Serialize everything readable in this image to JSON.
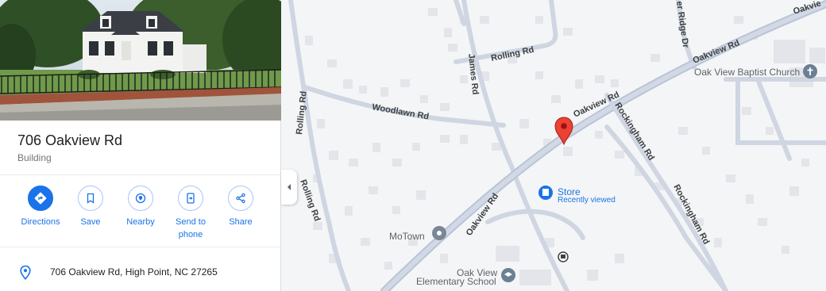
{
  "place": {
    "title": "706 Oakview Rd",
    "category": "Building",
    "address": "706 Oakview Rd, High Point, NC 27265"
  },
  "actions": [
    {
      "id": "directions",
      "label": "Directions",
      "icon": "directions-icon"
    },
    {
      "id": "save",
      "label": "Save",
      "icon": "bookmark-icon"
    },
    {
      "id": "nearby",
      "label": "Nearby",
      "icon": "nearby-icon"
    },
    {
      "id": "send",
      "label": "Send to phone",
      "label_line1": "Send to",
      "label_line2": "phone",
      "icon": "send-to-phone-icon"
    },
    {
      "id": "share",
      "label": "Share",
      "icon": "share-icon"
    }
  ],
  "map": {
    "roads": {
      "oakview_top": "Oakvie",
      "oakview_upper": "Oakview Rd",
      "oakview_mid": "Oakview Rd",
      "oakview_lower": "Oakview Rd",
      "james": "James Rd",
      "rolling_top": "Rolling Rd",
      "rolling_left": "Rolling Rd",
      "rolling_lower": "Rolling Rd",
      "woodlawn": "Woodlawn Rd",
      "rockingham_1": "Rockingham Rd",
      "rockingham_2": "Rockingham Rd",
      "ridge": "er Ridge Dr"
    },
    "pois": {
      "church": "Oak View Baptist Church",
      "store": "Store",
      "store_sub": "Recently viewed",
      "motown": "MoTown",
      "school_1": "Oak View",
      "school_2": "Elementary School"
    },
    "colors": {
      "road": "#c6cdd9",
      "road_major": "#b7c2d6",
      "pin": "#ea4335",
      "accent": "#1a73e8"
    }
  }
}
